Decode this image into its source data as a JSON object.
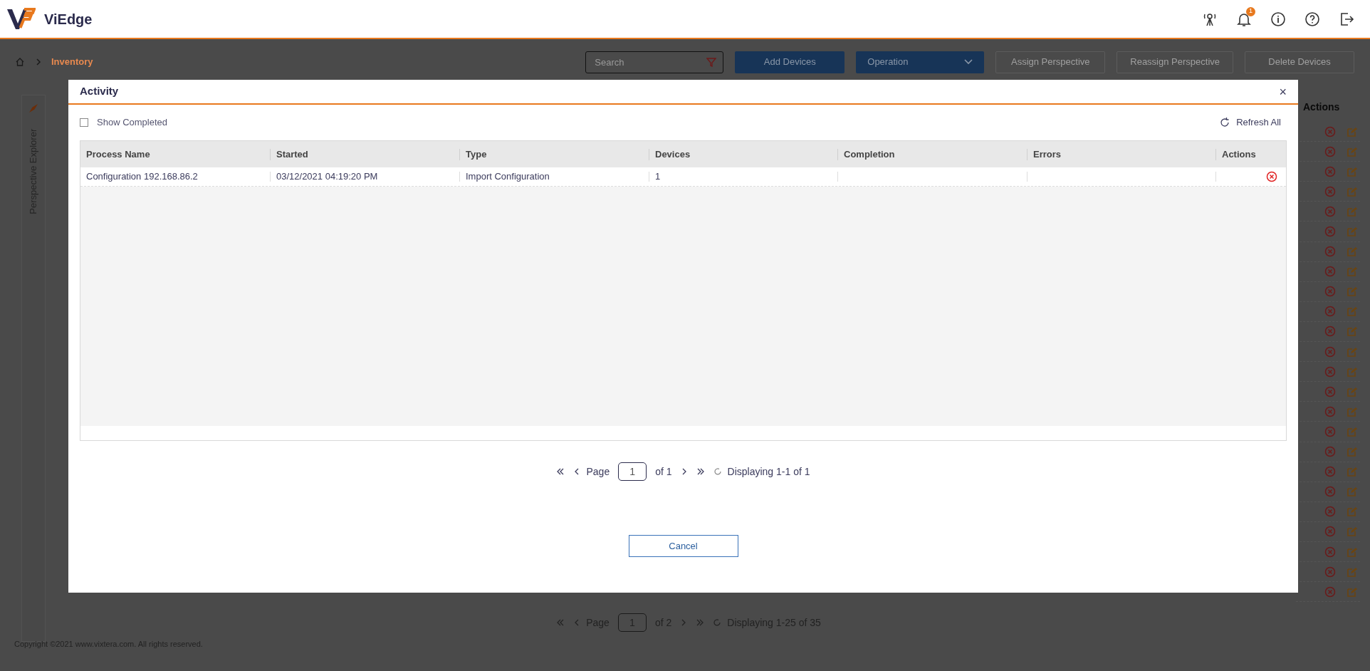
{
  "header": {
    "brand": "ViEdge",
    "notification_badge": "1"
  },
  "breadcrumb": {
    "current": "Inventory"
  },
  "toolbar": {
    "search": {
      "placeholder": "Search"
    },
    "items": [
      {
        "kind": "button",
        "label": "Add Devices",
        "disabled": false
      },
      {
        "kind": "dropdown",
        "label": "Operation",
        "disabled": false
      },
      {
        "kind": "button",
        "label": "Assign Perspective",
        "disabled": true
      },
      {
        "kind": "button",
        "label": "Reassign Perspective",
        "disabled": true
      },
      {
        "kind": "button",
        "label": "Delete Devices",
        "disabled": true
      }
    ]
  },
  "sidebar": {
    "label": "Perspective Explorer"
  },
  "background_table": {
    "column": "Actions"
  },
  "background_pagination": {
    "page_label": "Page",
    "page": "1",
    "of": "of 2",
    "displaying": "Displaying 1-25 of 35"
  },
  "footer": {
    "copyright": "Copyright ©2021 www.vixtera.com. All rights reserved."
  },
  "dialog": {
    "title": "Activity",
    "close": "×",
    "show_completed": {
      "label": "Show Completed",
      "checked": false
    },
    "refresh": "Refresh All",
    "table": {
      "columns": [
        "Process Name",
        "Started",
        "Type",
        "Devices",
        "Completion",
        "Errors",
        "Actions"
      ],
      "rows": [
        {
          "process_name": "Configuration 192.168.86.2",
          "started": "03/12/2021 04:19:20 PM",
          "type": "Import Configuration",
          "devices": "1"
        }
      ]
    },
    "pagination": {
      "page_label": "Page",
      "page": "1",
      "of": "of 1",
      "displaying": "Displaying 1-1 of 1"
    },
    "cancel": "Cancel"
  }
}
